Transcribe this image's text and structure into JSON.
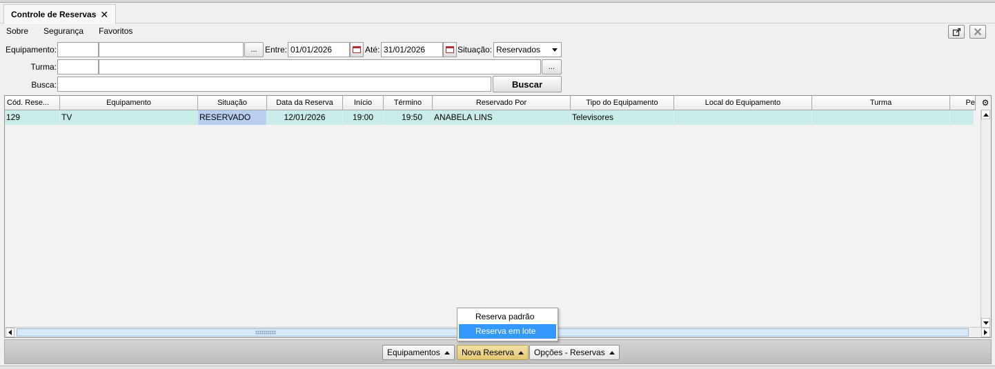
{
  "tab": {
    "title": "Controle de Reservas",
    "close": "✕"
  },
  "menu": [
    "Sobre",
    "Segurança",
    "Favoritos"
  ],
  "window_buttons": {
    "popout_icon": "external-window-icon",
    "close_icon": "close-icon"
  },
  "filters": {
    "equipamento_label": "Equipamento:",
    "equipamento_code": "",
    "equipamento_name": "",
    "lookup_label": "...",
    "entre_label": "Entre:",
    "entre_value": "01/01/2026",
    "ate_label": "Até:",
    "ate_value": "31/01/2026",
    "situacao_label": "Situação:",
    "situacao_value": "Reservados",
    "turma_label": "Turma:",
    "turma_code": "",
    "turma_name": "",
    "busca_label": "Busca:",
    "busca_value": "",
    "buscar_button": "Buscar"
  },
  "grid": {
    "columns": [
      "Cód. Rese...",
      "Equipamento",
      "Situação",
      "Data da Reserva",
      "Início",
      "Término",
      "Reservado Por",
      "Tipo do Equipamento",
      "Local do Equipamento",
      "Turma",
      "Pe"
    ],
    "rows": [
      {
        "codigo": "129",
        "equipamento": "TV",
        "situacao": "RESERVADO",
        "data": "12/01/2026",
        "inicio": "19:00",
        "termino": "19:50",
        "reservado_por": "ANABELA LINS",
        "tipo": "Televisores",
        "local": "",
        "turma": "",
        "pe": ""
      }
    ]
  },
  "bottom_buttons": {
    "equipamentos": "Equipamentos",
    "nova_reserva": "Nova Reserva",
    "opcoes": "Opções - Reservas"
  },
  "popup": {
    "items": [
      "Reserva padrão",
      "Reserva em lote"
    ],
    "highlighted": "Reserva em lote"
  },
  "colors": {
    "row_bg": "#c9ece9",
    "selected_cell": "#b9cff0",
    "menu_highlight": "#3399ff",
    "active_button": "#e3c775"
  }
}
